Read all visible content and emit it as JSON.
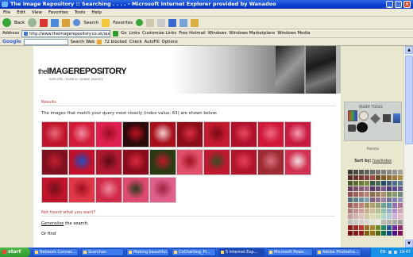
{
  "window": {
    "title": "The Image Repository :: Searching . . . . - Microsoft Internet Explorer provided by Wanadoo"
  },
  "menu": [
    "File",
    "Edit",
    "View",
    "Favorites",
    "Tools",
    "Help"
  ],
  "toolbar": {
    "back_label": "Back",
    "search_label": "Search",
    "favorites_label": "Favorites"
  },
  "addressbar": {
    "label": "Address",
    "url": "http://www.theimagerepository.co.uk/query.php?index=vel",
    "go_label": "Go",
    "links": [
      "Links",
      "Customize Links",
      "Free Hotmail",
      "Windows",
      "Windows Marketplace",
      "Windows Media"
    ]
  },
  "googlebar": {
    "logo": "Google",
    "search_web": "Search Web",
    "blocked": "72 blocked",
    "check": "Check",
    "autofill": "AutoFill",
    "options": "Options"
  },
  "site": {
    "logo_pre": "the",
    "logo_main": "IMAGEREPOSITORY",
    "tagline": "EXPLORE. SEARCH. SHARE IMAGES"
  },
  "results": {
    "title": "Results",
    "intro": "The images that match your query most closely (index value, 63) are shown below:",
    "images": [
      {
        "c1": "#c0142a",
        "c2": "#e8687a"
      },
      {
        "c1": "#d21c3a",
        "c2": "#f28aa0"
      },
      {
        "c1": "#e02050",
        "c2": "#9a0f20"
      },
      {
        "c1": "#2a0a0a",
        "c2": "#c01020"
      },
      {
        "c1": "#a8101c",
        "c2": "#f2d0d0"
      },
      {
        "c1": "#8c0c18",
        "c2": "#d83040"
      },
      {
        "c1": "#c51a30",
        "c2": "#7a0a14"
      },
      {
        "c1": "#b0102a",
        "c2": "#e84a60"
      },
      {
        "c1": "#d01838",
        "c2": "#f06a80"
      },
      {
        "c1": "#c81a40",
        "c2": "#f49ab0"
      },
      {
        "c1": "#7e1020",
        "c2": "#c02030"
      },
      {
        "c1": "#c0102c",
        "c2": "#2050c0"
      },
      {
        "c1": "#b01830",
        "c2": "#5a0a12"
      },
      {
        "c1": "#8a0c1c",
        "c2": "#d82a3c"
      },
      {
        "c1": "#2c3a14",
        "c2": "#c01828"
      },
      {
        "c1": "#e0506a",
        "c2": "#a01020"
      },
      {
        "c1": "#c01830",
        "c2": "#3a4a20"
      },
      {
        "c1": "#b0142a",
        "c2": "#e8405a"
      },
      {
        "c1": "#9c2a30",
        "c2": "#d87080"
      },
      {
        "c1": "#d03050",
        "c2": "#f4e0e4"
      },
      {
        "c1": "#c0142a",
        "c2": "#70101a"
      },
      {
        "c1": "#e03848",
        "c2": "#a01020"
      },
      {
        "c1": "#d02a48",
        "c2": "#f08aa0"
      },
      {
        "c1": "#e04a70",
        "c2": "#2a3a1a"
      },
      {
        "c1": "#e0608a",
        "c2": "#a02040"
      }
    ]
  },
  "notfound": {
    "title": "Not found what you want?",
    "generalise_link": "Generalise",
    "generalise_rest": "the search.",
    "or_find": "Or find"
  },
  "rpanel": {
    "query_tools": "QUERY TOOLS",
    "palette": "Palette",
    "sort_label": "Sort by:",
    "sort_value": "hue/index"
  },
  "palette_colors": [
    "#3a3a3a",
    "#4a4a4a",
    "#555555",
    "#606060",
    "#6a6a6a",
    "#757575",
    "#808080",
    "#8a8a8a",
    "#959595",
    "#a0a0a0",
    "#5a2a2a",
    "#6a3030",
    "#7a3838",
    "#8a4040",
    "#9a4848",
    "#6a4a2a",
    "#7a5a30",
    "#8a6a38",
    "#9a7a40",
    "#aa8a48",
    "#4a5a2a",
    "#5a6a30",
    "#6a7a38",
    "#7a8a40",
    "#3a5a4a",
    "#4a6a5a",
    "#2a4a6a",
    "#3a5a7a",
    "#4a6a8a",
    "#5a7a9a",
    "#6a3a5a",
    "#7a4a6a",
    "#8a5a7a",
    "#9a6a8a",
    "#5a3a6a",
    "#6a4a7a",
    "#7a5a8a",
    "#4a3a7a",
    "#5a4a8a",
    "#6a5a9a",
    "#8a5050",
    "#9a6060",
    "#aa7070",
    "#ba8080",
    "#8a7050",
    "#9a8060",
    "#aa9070",
    "#7a8a60",
    "#8a9a70",
    "#6a8a7a",
    "#507080",
    "#608090",
    "#7090a0",
    "#80a0b0",
    "#806080",
    "#907090",
    "#a080a0",
    "#7070a0",
    "#8080b0",
    "#9090c0",
    "#a06060",
    "#b07070",
    "#c08080",
    "#a09060",
    "#b0a070",
    "#90a070",
    "#70a090",
    "#6090b0",
    "#9070b0",
    "#b070a0",
    "#b08080",
    "#c09090",
    "#d0a0a0",
    "#c0b090",
    "#d0c0a0",
    "#b0c090",
    "#90c0b0",
    "#90b0d0",
    "#b090d0",
    "#d0a0c0",
    "#c0a0a0",
    "#d0b0b0",
    "#e0c0c0",
    "#d0c8a8",
    "#e0d8b8",
    "#c8d8b0",
    "#b0d8c8",
    "#b0c8e0",
    "#c8b0e0",
    "#e0b8d0",
    "#c0c0c0",
    "#c8c8c8",
    "#d0d0d0",
    "#d8d8d8",
    "#e0e0e0",
    "#e8e8e8",
    "#b8b8b8",
    "#b0b0b0",
    "#a8a8a8",
    "#a0a0a0",
    "#8a1818",
    "#9a2828",
    "#b83838",
    "#987028",
    "#a88838",
    "#6a8a28",
    "#288a6a",
    "#285a9a",
    "#6a289a",
    "#9a2870",
    "#701010",
    "#801818",
    "#902020",
    "#806010",
    "#907018",
    "#506a10",
    "#106a50",
    "#104a80",
    "#501080",
    "#801058"
  ],
  "taskbar": {
    "start": "start",
    "items": [
      "Network Connec...",
      "Scarchan",
      "Making beautiful...",
      "CoCharting_Pl...",
      "5 Internet Exp...",
      "Microsoft Powe...",
      "Adobe Photosho..."
    ],
    "lang": "EN",
    "clock": "19:47"
  }
}
